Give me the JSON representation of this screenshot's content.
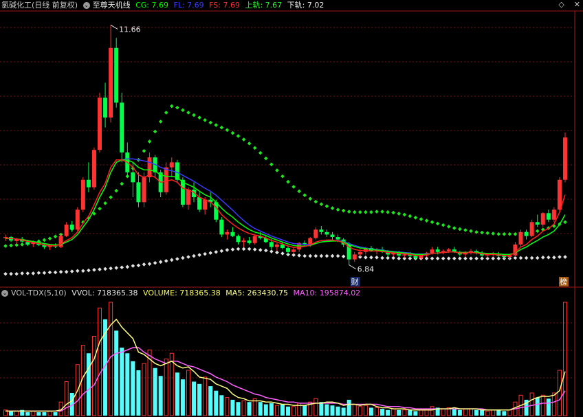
{
  "header": {
    "stock_name": "氯碱化工(日线 前复权)",
    "indicator_name": "至尊天机线",
    "cg_label": "CG: 7.69",
    "fl_label": "FL: 7.69",
    "fs_label": "FS: 7.69",
    "upper_label": "上轨: 7.67",
    "lower_label": "下轨: 7.02"
  },
  "top_icons": {
    "diamond": "◇",
    "close": "✕"
  },
  "annotations": {
    "high": "11.66",
    "low": "6.84",
    "cai_marker": "财",
    "bang_marker": "榜"
  },
  "volume_header": {
    "indicator": "VOL-TDX(5,10)",
    "vvol": "VVOL: 718365.38",
    "volume": "VOLUME: 718365.38",
    "ma5": "MA5: 263430.75",
    "ma10": "MA10: 195874.02"
  },
  "colors": {
    "up": "#ff3232",
    "down": "#00ff4a",
    "cg": "#00ff00",
    "fl": "#3a3aff",
    "fs": "#ff2020",
    "upper_dots": "#1ee61e",
    "lower_dots": "#e0e0e0",
    "vol_down": "#54fcfc",
    "ma5": "#ffff80",
    "ma10": "#ff60ff",
    "grid": "#7a1010"
  },
  "chart_data": {
    "type": "candlestick",
    "ohlc": [
      [
        7.38,
        7.45,
        7.32,
        7.4
      ],
      [
        7.4,
        7.42,
        7.3,
        7.33
      ],
      [
        7.32,
        7.38,
        7.26,
        7.36
      ],
      [
        7.36,
        7.4,
        7.29,
        7.31
      ],
      [
        7.3,
        7.34,
        7.22,
        7.25
      ],
      [
        7.26,
        7.33,
        7.2,
        7.3
      ],
      [
        7.3,
        7.35,
        7.22,
        7.24
      ],
      [
        7.24,
        7.28,
        7.16,
        7.2
      ],
      [
        7.2,
        7.26,
        7.14,
        7.23
      ],
      [
        7.23,
        7.27,
        7.18,
        7.21
      ],
      [
        7.2,
        7.45,
        7.18,
        7.42
      ],
      [
        7.42,
        7.7,
        7.4,
        7.65
      ],
      [
        7.65,
        7.72,
        7.5,
        7.55
      ],
      [
        7.55,
        8.0,
        7.52,
        7.95
      ],
      [
        7.95,
        8.6,
        7.9,
        8.55
      ],
      [
        8.55,
        8.9,
        8.3,
        8.4
      ],
      [
        8.4,
        9.2,
        8.35,
        9.15
      ],
      [
        9.15,
        10.3,
        9.1,
        10.2
      ],
      [
        10.2,
        10.5,
        9.6,
        9.8
      ],
      [
        9.8,
        11.66,
        9.7,
        11.2
      ],
      [
        11.2,
        11.4,
        10.0,
        10.1
      ],
      [
        10.1,
        10.3,
        8.9,
        9.1
      ],
      [
        9.1,
        9.3,
        8.6,
        8.7
      ],
      [
        8.7,
        8.9,
        8.2,
        8.5
      ],
      [
        8.5,
        8.7,
        8.0,
        8.1
      ],
      [
        8.1,
        8.7,
        8.0,
        8.6
      ],
      [
        8.6,
        9.1,
        8.5,
        9.0
      ],
      [
        9.0,
        9.05,
        8.6,
        8.7
      ],
      [
        8.7,
        8.75,
        8.2,
        8.3
      ],
      [
        8.3,
        8.9,
        8.25,
        8.8
      ],
      [
        8.8,
        9.0,
        8.6,
        8.9
      ],
      [
        8.9,
        8.95,
        8.5,
        8.55
      ],
      [
        8.55,
        8.6,
        8.0,
        8.05
      ],
      [
        8.05,
        8.4,
        7.95,
        8.35
      ],
      [
        8.35,
        8.5,
        8.1,
        8.2
      ],
      [
        8.2,
        8.3,
        7.9,
        7.95
      ],
      [
        7.95,
        8.2,
        7.85,
        8.15
      ],
      [
        8.15,
        8.3,
        8.0,
        8.1
      ],
      [
        8.1,
        8.15,
        7.7,
        7.75
      ],
      [
        7.75,
        7.8,
        7.4,
        7.45
      ],
      [
        7.45,
        7.55,
        7.35,
        7.5
      ],
      [
        7.5,
        7.6,
        7.4,
        7.42
      ],
      [
        7.42,
        7.45,
        7.25,
        7.3
      ],
      [
        7.3,
        7.38,
        7.2,
        7.33
      ],
      [
        7.33,
        7.4,
        7.25,
        7.28
      ],
      [
        7.28,
        7.45,
        7.25,
        7.42
      ],
      [
        7.42,
        7.5,
        7.35,
        7.38
      ],
      [
        7.38,
        7.42,
        7.28,
        7.3
      ],
      [
        7.3,
        7.36,
        7.15,
        7.2
      ],
      [
        7.2,
        7.28,
        7.12,
        7.25
      ],
      [
        7.25,
        7.3,
        7.15,
        7.18
      ],
      [
        7.18,
        7.22,
        7.05,
        7.1
      ],
      [
        7.1,
        7.2,
        7.05,
        7.15
      ],
      [
        7.15,
        7.3,
        7.1,
        7.28
      ],
      [
        7.28,
        7.33,
        7.2,
        7.25
      ],
      [
        7.25,
        7.4,
        7.2,
        7.38
      ],
      [
        7.38,
        7.6,
        7.35,
        7.55
      ],
      [
        7.55,
        7.62,
        7.45,
        7.5
      ],
      [
        7.5,
        7.55,
        7.4,
        7.45
      ],
      [
        7.45,
        7.5,
        7.35,
        7.4
      ],
      [
        7.4,
        7.45,
        7.3,
        7.35
      ],
      [
        7.35,
        7.38,
        7.2,
        7.25
      ],
      [
        7.25,
        7.3,
        6.84,
        6.95
      ],
      [
        6.95,
        7.1,
        6.9,
        7.05
      ],
      [
        7.05,
        7.15,
        7.0,
        7.1
      ],
      [
        7.1,
        7.2,
        7.05,
        7.18
      ],
      [
        7.18,
        7.22,
        7.1,
        7.12
      ],
      [
        7.12,
        7.18,
        7.05,
        7.15
      ],
      [
        7.15,
        7.2,
        7.08,
        7.1
      ],
      [
        7.1,
        7.14,
        7.0,
        7.05
      ],
      [
        7.05,
        7.1,
        7.0,
        7.08
      ],
      [
        7.08,
        7.12,
        7.0,
        7.03
      ],
      [
        7.03,
        7.08,
        6.98,
        7.05
      ],
      [
        7.05,
        7.1,
        7.0,
        7.02
      ],
      [
        7.02,
        7.06,
        6.95,
        6.98
      ],
      [
        6.98,
        7.05,
        6.95,
        7.03
      ],
      [
        7.03,
        7.1,
        7.0,
        7.08
      ],
      [
        7.08,
        7.2,
        7.05,
        7.15
      ],
      [
        7.15,
        7.2,
        7.05,
        7.1
      ],
      [
        7.1,
        7.15,
        7.05,
        7.12
      ],
      [
        7.12,
        7.18,
        7.08,
        7.15
      ],
      [
        7.15,
        7.2,
        7.08,
        7.1
      ],
      [
        7.1,
        7.12,
        7.02,
        7.05
      ],
      [
        7.05,
        7.12,
        7.0,
        7.1
      ],
      [
        7.1,
        7.16,
        7.05,
        7.12
      ],
      [
        7.12,
        7.15,
        7.05,
        7.08
      ],
      [
        7.08,
        7.12,
        7.0,
        7.03
      ],
      [
        7.03,
        7.08,
        6.98,
        7.05
      ],
      [
        7.05,
        7.1,
        7.0,
        7.06
      ],
      [
        7.06,
        7.1,
        7.0,
        7.02
      ],
      [
        7.02,
        7.06,
        6.96,
        7.0
      ],
      [
        7.0,
        7.05,
        6.95,
        7.03
      ],
      [
        7.03,
        7.3,
        7.0,
        7.25
      ],
      [
        7.25,
        7.55,
        7.2,
        7.5
      ],
      [
        7.5,
        7.55,
        7.35,
        7.42
      ],
      [
        7.42,
        7.75,
        7.4,
        7.7
      ],
      [
        7.7,
        7.85,
        7.6,
        7.65
      ],
      [
        7.65,
        7.9,
        7.6,
        7.88
      ],
      [
        7.88,
        7.95,
        7.7,
        7.75
      ],
      [
        7.75,
        8.0,
        7.7,
        7.95
      ],
      [
        7.95,
        8.6,
        7.9,
        8.55
      ],
      [
        8.55,
        9.5,
        8.5,
        9.4
      ]
    ],
    "series_lines": {
      "cg": [
        7.37,
        7.37,
        7.36,
        7.35,
        7.33,
        7.31,
        7.29,
        7.27,
        7.25,
        7.24,
        7.25,
        7.3,
        7.35,
        7.45,
        7.6,
        7.75,
        7.95,
        8.2,
        8.4,
        8.7,
        8.9,
        8.95,
        8.95,
        8.9,
        8.8,
        8.75,
        8.75,
        8.72,
        8.65,
        8.62,
        8.62,
        8.6,
        8.5,
        8.45,
        8.4,
        8.32,
        8.25,
        8.2,
        8.1,
        7.98,
        7.88,
        7.8,
        7.7,
        7.62,
        7.55,
        7.5,
        7.47,
        7.43,
        7.38,
        7.34,
        7.3,
        7.26,
        7.23,
        7.22,
        7.22,
        7.23,
        7.27,
        7.3,
        7.31,
        7.32,
        7.32,
        7.3,
        7.25,
        7.21,
        7.18,
        7.17,
        7.15,
        7.14,
        7.13,
        7.11,
        7.1,
        7.09,
        7.08,
        7.07,
        7.05,
        7.05,
        7.05,
        7.07,
        7.08,
        7.09,
        7.1,
        7.1,
        7.09,
        7.09,
        7.09,
        7.09,
        7.08,
        7.07,
        7.07,
        7.06,
        7.05,
        7.05,
        7.08,
        7.15,
        7.2,
        7.27,
        7.33,
        7.4,
        7.45,
        7.52,
        7.65,
        7.85
      ],
      "fl": [
        7.37,
        7.37,
        7.36,
        7.35,
        7.33,
        7.31,
        7.29,
        7.27,
        7.25,
        7.24,
        7.25,
        7.3,
        7.35,
        7.45,
        7.6,
        7.75,
        7.95,
        8.2,
        8.4,
        8.7,
        8.9,
        8.95,
        8.97,
        8.97,
        8.95,
        8.93,
        8.9,
        8.86,
        8.8,
        8.76,
        8.73,
        8.7,
        8.64,
        8.58,
        8.52,
        8.45,
        8.38,
        8.32,
        8.24,
        8.14,
        8.04,
        7.94,
        7.83,
        7.73,
        7.64,
        7.57,
        7.52,
        7.47,
        7.42,
        7.38,
        7.34,
        7.3,
        7.27,
        7.26,
        7.25,
        7.25,
        7.27,
        7.3,
        7.32,
        7.33,
        7.33,
        7.31,
        7.27,
        7.23,
        7.2,
        7.18,
        7.16,
        7.15,
        7.14,
        7.12,
        7.11,
        7.1,
        7.09,
        7.08,
        7.06,
        7.06,
        7.06,
        7.07,
        7.08,
        7.09,
        7.1,
        7.1,
        7.09,
        7.09,
        7.09,
        7.09,
        7.08,
        7.07,
        7.07,
        7.06,
        7.05,
        7.05,
        7.08,
        7.15,
        7.2,
        7.27,
        7.33,
        7.4,
        7.45,
        7.52,
        7.65,
        7.85
      ],
      "fs": [
        7.38,
        7.37,
        7.36,
        7.34,
        7.31,
        7.29,
        7.27,
        7.24,
        7.23,
        7.22,
        7.26,
        7.33,
        7.39,
        7.5,
        7.68,
        7.82,
        8.05,
        8.3,
        8.48,
        8.8,
        8.95,
        8.95,
        8.9,
        8.8,
        8.65,
        8.6,
        8.65,
        8.6,
        8.5,
        8.52,
        8.55,
        8.5,
        8.38,
        8.35,
        8.3,
        8.2,
        8.15,
        8.1,
        8.0,
        7.85,
        7.75,
        7.66,
        7.58,
        7.52,
        7.47,
        7.44,
        7.42,
        7.38,
        7.33,
        7.3,
        7.26,
        7.22,
        7.19,
        7.2,
        7.21,
        7.24,
        7.3,
        7.33,
        7.34,
        7.34,
        7.32,
        7.29,
        7.2,
        7.15,
        7.13,
        7.13,
        7.12,
        7.12,
        7.11,
        7.09,
        7.08,
        7.07,
        7.06,
        7.05,
        7.03,
        7.03,
        7.04,
        7.07,
        7.08,
        7.09,
        7.1,
        7.1,
        7.08,
        7.08,
        7.09,
        7.08,
        7.06,
        7.05,
        7.05,
        7.04,
        7.03,
        7.03,
        7.09,
        7.2,
        7.25,
        7.35,
        7.42,
        7.52,
        7.57,
        7.66,
        7.9,
        8.25
      ]
    },
    "upper_band": [
      7.22,
      7.23,
      7.24,
      7.25,
      7.27,
      7.29,
      7.31,
      7.34,
      7.37,
      7.41,
      7.45,
      7.5,
      7.56,
      7.63,
      7.7,
      7.78,
      7.87,
      7.97,
      8.08,
      8.2,
      8.33,
      8.47,
      8.62,
      8.78,
      8.95,
      9.13,
      9.32,
      9.52,
      9.72,
      9.9,
      10.03,
      10.0,
      9.95,
      9.9,
      9.85,
      9.8,
      9.75,
      9.7,
      9.65,
      9.6,
      9.55,
      9.49,
      9.43,
      9.36,
      9.28,
      9.19,
      9.09,
      8.98,
      8.86,
      8.74,
      8.62,
      8.51,
      8.41,
      8.32,
      8.24,
      8.17,
      8.11,
      8.06,
      8.02,
      7.98,
      7.95,
      7.93,
      7.91,
      7.9,
      7.9,
      7.9,
      7.9,
      7.91,
      7.91,
      7.9,
      7.89,
      7.87,
      7.85,
      7.82,
      7.79,
      7.76,
      7.73,
      7.7,
      7.67,
      7.64,
      7.61,
      7.58,
      7.56,
      7.54,
      7.52,
      7.5,
      7.49,
      7.48,
      7.47,
      7.46,
      7.46,
      7.46,
      7.46,
      7.47,
      7.48,
      7.5,
      7.52,
      7.55,
      7.58,
      7.62,
      7.66,
      7.7
    ],
    "lower_band": [
      6.66,
      6.66,
      6.66,
      6.67,
      6.67,
      6.67,
      6.68,
      6.68,
      6.69,
      6.69,
      6.7,
      6.7,
      6.71,
      6.72,
      6.72,
      6.73,
      6.74,
      6.75,
      6.76,
      6.77,
      6.78,
      6.79,
      6.8,
      6.82,
      6.83,
      6.85,
      6.86,
      6.88,
      6.9,
      6.92,
      6.94,
      6.96,
      6.98,
      7.0,
      7.02,
      7.04,
      7.06,
      7.08,
      7.1,
      7.12,
      7.14,
      7.15,
      7.16,
      7.16,
      7.16,
      7.15,
      7.14,
      7.13,
      7.11,
      7.09,
      7.07,
      7.05,
      7.04,
      7.03,
      7.02,
      7.02,
      7.02,
      7.02,
      7.02,
      7.02,
      7.02,
      7.01,
      7.01,
      7.0,
      7.0,
      6.99,
      6.99,
      6.99,
      6.98,
      6.98,
      6.98,
      6.97,
      6.97,
      6.97,
      6.97,
      6.97,
      6.97,
      6.97,
      6.97,
      6.97,
      6.97,
      6.97,
      6.97,
      6.97,
      6.97,
      6.97,
      6.97,
      6.97,
      6.97,
      6.97,
      6.97,
      6.97,
      6.98,
      6.98,
      6.98,
      6.98,
      6.98,
      6.99,
      6.99,
      6.99,
      7.0,
      7.0
    ],
    "volume": [
      5,
      4,
      4,
      5,
      3,
      4,
      3,
      3,
      4,
      3,
      12,
      30,
      20,
      45,
      62,
      55,
      70,
      95,
      85,
      100,
      75,
      60,
      55,
      48,
      40,
      46,
      58,
      42,
      35,
      50,
      55,
      38,
      32,
      40,
      30,
      28,
      34,
      26,
      22,
      18,
      16,
      14,
      12,
      13,
      12,
      15,
      12,
      10,
      11,
      9,
      10,
      8,
      8,
      11,
      9,
      12,
      15,
      12,
      10,
      9,
      8,
      7,
      14,
      10,
      8,
      9,
      7,
      7,
      6,
      5,
      6,
      5,
      5,
      5,
      4,
      5,
      6,
      8,
      7,
      6,
      7,
      6,
      5,
      6,
      6,
      5,
      5,
      4,
      5,
      5,
      4,
      5,
      12,
      18,
      14,
      20,
      16,
      18,
      15,
      20,
      40,
      100
    ],
    "ma5": [
      4,
      4,
      4,
      4,
      4,
      4,
      4,
      4,
      4,
      4,
      5,
      10,
      13,
      22,
      34,
      42,
      50,
      65,
      73,
      80,
      85,
      78,
      73,
      68,
      56,
      54,
      50,
      46,
      44,
      46,
      48,
      44,
      42,
      43,
      39,
      34,
      33,
      32,
      28,
      26,
      24,
      19,
      16,
      15,
      13,
      13,
      13,
      12,
      12,
      11,
      10,
      10,
      9,
      9,
      9,
      10,
      11,
      11,
      12,
      12,
      11,
      9,
      10,
      10,
      9,
      10,
      10,
      8,
      7,
      7,
      6,
      6,
      6,
      5,
      5,
      5,
      5,
      5,
      6,
      6,
      6,
      7,
      6,
      6,
      6,
      6,
      5,
      5,
      5,
      5,
      5,
      5,
      7,
      9,
      11,
      14,
      16,
      17,
      17,
      18,
      22,
      39
    ],
    "ma10": [
      4,
      4,
      4,
      4,
      4,
      4,
      4,
      4,
      4,
      4,
      4,
      7,
      9,
      13,
      19,
      23,
      27,
      37,
      44,
      52,
      55,
      56,
      58,
      60,
      60,
      56,
      53,
      50,
      48,
      46,
      48,
      48,
      46,
      44,
      43,
      41,
      39,
      37,
      34,
      32,
      30,
      27,
      25,
      23,
      21,
      19,
      18,
      16,
      15,
      14,
      13,
      12,
      12,
      11,
      11,
      11,
      11,
      11,
      11,
      11,
      11,
      10,
      10,
      10,
      10,
      10,
      10,
      10,
      9,
      8,
      8,
      8,
      7,
      7,
      6,
      6,
      6,
      6,
      6,
      6,
      6,
      6,
      6,
      6,
      6,
      6,
      6,
      5,
      5,
      5,
      5,
      5,
      6,
      7,
      8,
      9,
      10,
      11,
      11,
      12,
      14,
      22
    ],
    "price_range": [
      6.6,
      11.9
    ],
    "volume_max": 100
  }
}
